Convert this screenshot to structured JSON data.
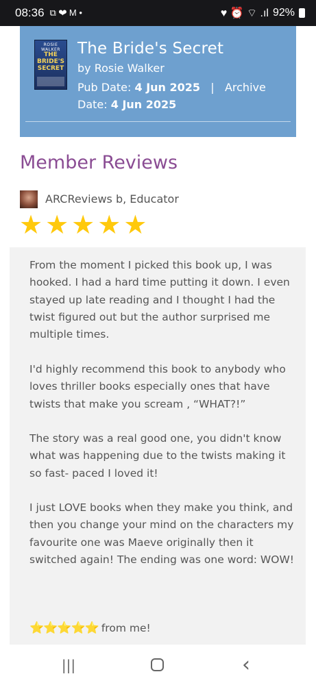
{
  "status_bar": {
    "time": "08:36",
    "left_icons": [
      "slack-icon",
      "heart-icon",
      "gmail-icon",
      "dot-icon"
    ],
    "notif_glyphs": "⧉ ❤ M •",
    "right_glyphs": "♥ ⏰ ⌔ .ıl",
    "battery": "92%"
  },
  "book": {
    "cover_author": "ROSIE WALKER",
    "cover_title": "THE BRIDE'S SECRET",
    "title": "The Bride's Secret",
    "author": "by Rosie Walker",
    "pub_label": "Pub Date:",
    "pub_date": "4 Jun 2025",
    "separator": "|",
    "archive_label": "Archive Date:",
    "archive_date": "4 Jun 2025"
  },
  "reviews": {
    "section_title": "Member Reviews",
    "reviewer": "ARCReviews b, Educator",
    "rating": 5,
    "paragraphs": [
      "From the moment I picked this book up, I was hooked. I had a hard time putting it down. I even stayed up late reading and I thought I had the twist figured out but the author surprised me multiple times.",
      "I'd highly recommend this book to anybody who loves thriller books especially ones that have twists that make you scream , “WHAT?!”",
      "The story was a real good one, you didn't know what was happening due to the twists making it so fast- paced I loved it!",
      "I just LOVE books when they make you think, and then you change your mind on the characters my favourite one was Maeve originally then it switched again! The ending was one word: WOW!"
    ],
    "closing_stars": "⭐⭐⭐⭐⭐",
    "closing_text": "from me!"
  },
  "nav": {
    "recent": "|||",
    "back": "‹"
  },
  "colors": {
    "header_bg": "#6ea0cf",
    "section_title": "#8a4c93",
    "star": "#ffc90c",
    "review_bg": "#f2f2f2"
  }
}
